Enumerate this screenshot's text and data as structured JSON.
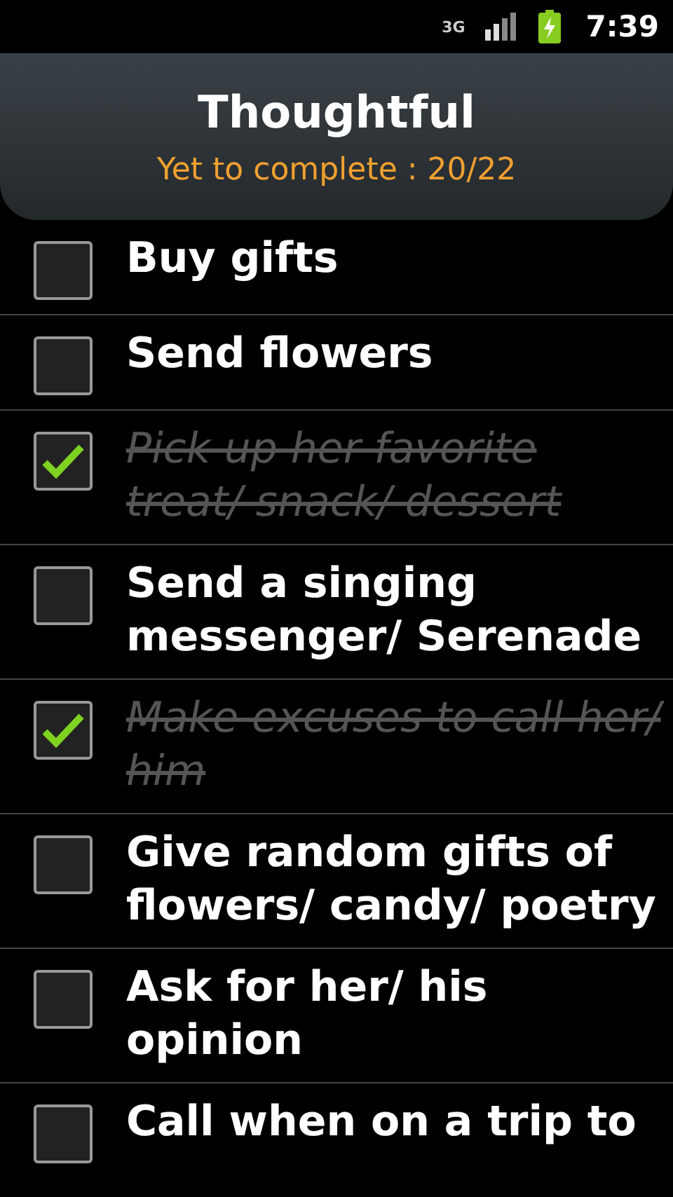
{
  "status_bar": {
    "network": "3G",
    "time": "7:39"
  },
  "header": {
    "title": "Thoughtful",
    "subtitle": "Yet to complete : 20/22"
  },
  "tasks": [
    {
      "label": "Buy gifts",
      "checked": false
    },
    {
      "label": "Send flowers",
      "checked": false
    },
    {
      "label": "Pick up her favorite treat/ snack/ dessert",
      "checked": true
    },
    {
      "label": "Send a singing messenger/ Serenade",
      "checked": false
    },
    {
      "label": "Make excuses to call her/ him",
      "checked": true
    },
    {
      "label": "Give random gifts of flowers/ candy/ poetry",
      "checked": false
    },
    {
      "label": "Ask for her/ his opinion",
      "checked": false
    },
    {
      "label": "Call when on a trip to",
      "checked": false
    }
  ]
}
